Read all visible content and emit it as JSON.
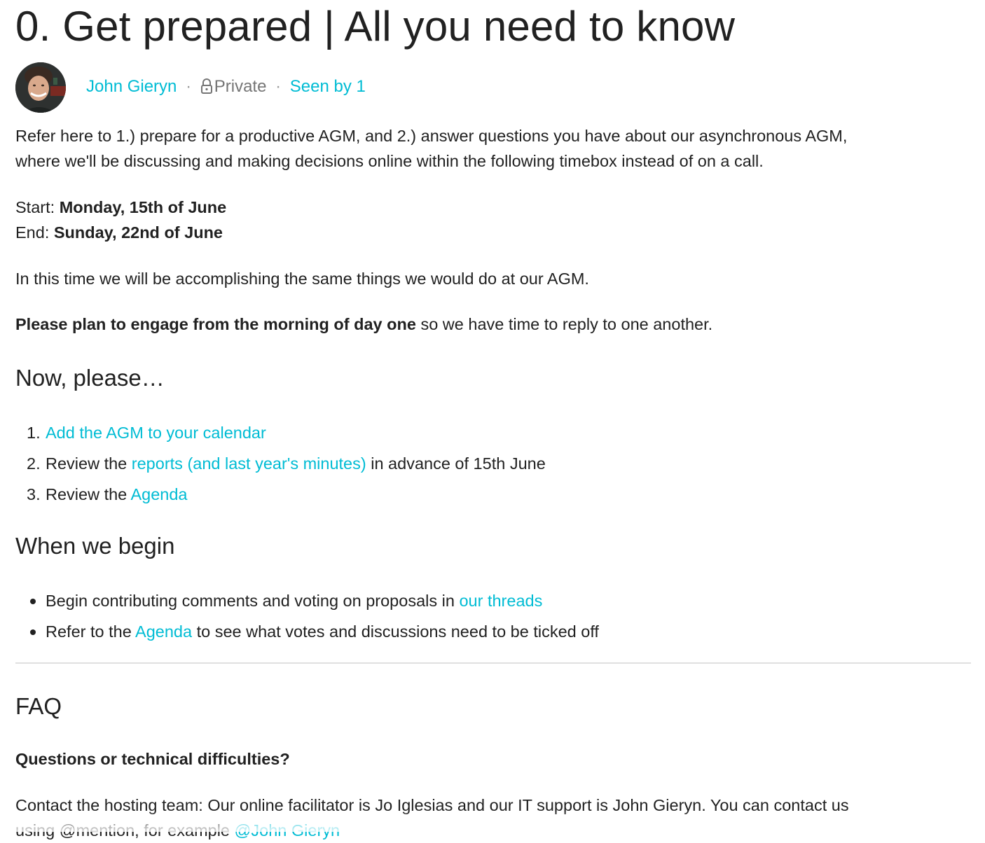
{
  "page": {
    "title": "0. Get prepared | All you need to know"
  },
  "author": {
    "name": "John Gieryn",
    "visibility": "Private",
    "seen_by": "Seen by 1",
    "separator": "·"
  },
  "body": {
    "intro_line1": "Refer here to 1.) prepare for a productive AGM, and 2.) answer questions you have about our asynchronous AGM,",
    "intro_line2": "where we'll be discussing and making decisions online within the following timebox instead of on a call.",
    "start_label": "Start: ",
    "start_value": "Monday, 15th of June",
    "end_label": "End: ",
    "end_value": "Sunday, 22nd of June",
    "same_things": "In this time we will be accomplishing the same things we would do at our AGM.",
    "plan_bold": "Please plan to engage from the morning of day one",
    "plan_rest": " so we have time to reply to one another."
  },
  "now_section": {
    "heading": "Now, please…",
    "items": [
      {
        "num": "1.",
        "prefix": "",
        "link": "Add the AGM to your calendar",
        "suffix": ""
      },
      {
        "num": "2.",
        "prefix": "Review the ",
        "link": "reports (and last year's minutes)",
        "suffix": " in advance of 15th June"
      },
      {
        "num": "3.",
        "prefix": "Review the ",
        "link": "Agenda",
        "suffix": ""
      }
    ]
  },
  "begin_section": {
    "heading": "When we begin",
    "items": [
      {
        "prefix": "Begin contributing comments and voting on proposals in ",
        "link": "our threads",
        "suffix": ""
      },
      {
        "prefix": "Refer to the ",
        "link": "Agenda",
        "suffix": " to see what votes and discussions need to be ticked off"
      }
    ]
  },
  "faq": {
    "heading": "FAQ",
    "question": "Questions or technical difficulties?",
    "contact_line1": "Contact the hosting team: Our online facilitator is Jo Iglesias and our IT support is John Gieryn. You can contact us",
    "contact_line2_prefix": "using @mention, for example ",
    "contact_mention": "@John Gieryn"
  },
  "colors": {
    "link": "#00bcd4",
    "text": "#212121",
    "muted": "#757575",
    "divider": "#e0e0e0"
  },
  "icons": {
    "lock": "lock-icon",
    "avatar": "avatar"
  }
}
